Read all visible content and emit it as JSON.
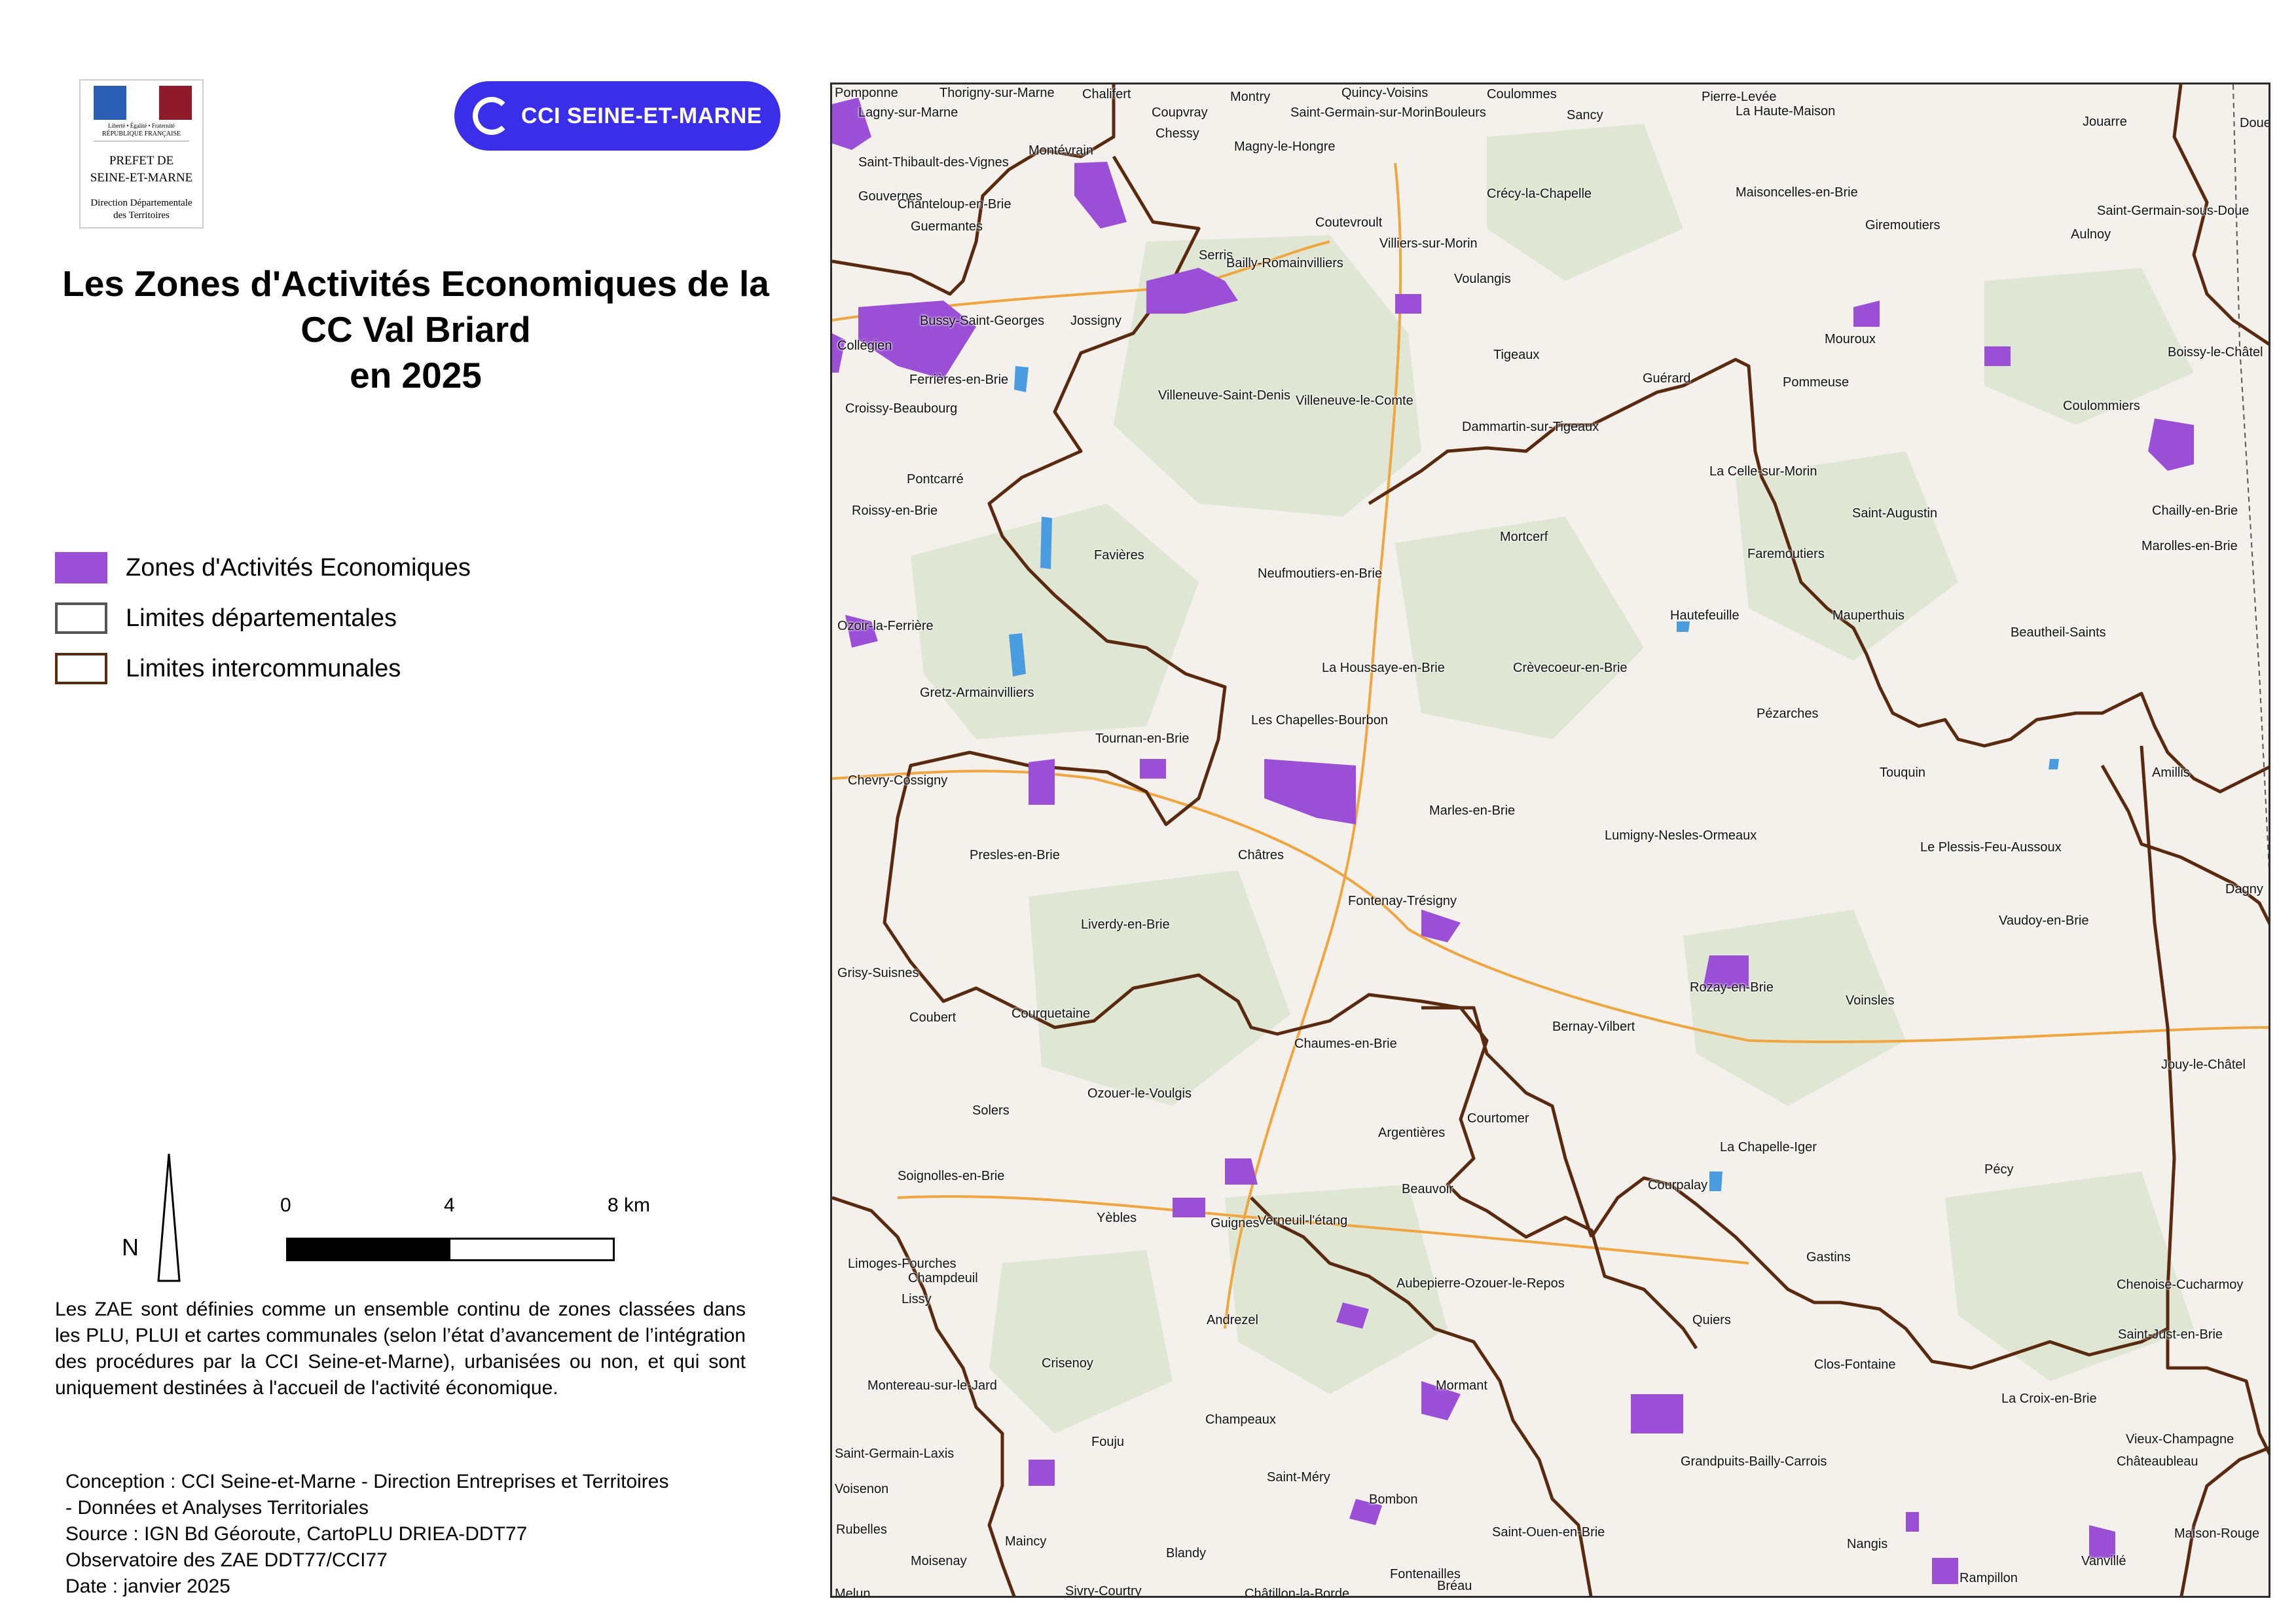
{
  "logos": {
    "prefet": {
      "motto": "Liberté • Égalité • Fraternité",
      "republic": "RÉPUBLIQUE FRANÇAISE",
      "line1": "PREFET DE",
      "line2": "SEINE-ET-MARNE",
      "line3": "Direction Départementale",
      "line4": "des Territoires",
      "flag_colors": [
        "#2a5fb5",
        "#ffffff",
        "#8f1a2a"
      ]
    },
    "cci": {
      "label": "CCI SEINE-ET-MARNE",
      "color": "#3a2ee8"
    }
  },
  "title": {
    "line1": "Les Zones d'Activités Economiques de la",
    "line2": "CC Val Briard",
    "line3": "en 2025"
  },
  "legend": [
    {
      "label": "Zones d'Activités Economiques",
      "fill": "#9b4fd6",
      "stroke": "#9b4fd6"
    },
    {
      "label": "Limites départementales",
      "fill": "#ffffff",
      "stroke": "#555555"
    },
    {
      "label": "Limites intercommunales",
      "fill": "#ffffff",
      "stroke": "#5a2a10"
    }
  ],
  "north_label": "N",
  "scale": {
    "labels": [
      "0",
      "4",
      "8 km"
    ]
  },
  "definition": "Les ZAE sont définies comme un ensemble continu de zones classées dans les PLU, PLUI et cartes communales (selon l’état d’avancement de l’intégration des procédures par la CCI Seine-et-Marne), urbanisées ou non, et qui sont uniquement destinées à l'accueil de l'activité économique.",
  "credits": [
    "Conception : CCI Seine-et-Marne - Direction Entreprises et Territoires",
    "- Données et Analyses Territoriales",
    "Source : IGN Bd Géoroute, CartoPLU DRIEA-DDT77",
    "Observatoire des ZAE DDT77/CCI77",
    "Date : janvier 2025"
  ],
  "map": {
    "colors": {
      "base": "#f4f1ec",
      "forest": "#dfe6d3",
      "zae": "#9b4fd6",
      "boundary": "#5a2a10",
      "road": "#f0a640",
      "water": "#4a9be0"
    },
    "towns": [
      "Pomponne",
      "Thorigny-sur-Marne",
      "Chalifert",
      "Montry",
      "Quincy-Voisins",
      "Coulommes",
      "Pierre-Levée",
      "Lagny-sur-Marne",
      "Coupvray",
      "Saint-Germain-sur-Morin",
      "Bouleurs",
      "Sancy",
      "La Haute-Maison",
      "Jouarre",
      "Doue",
      "Chessy",
      "Magny-le-Hongre",
      "Saint-Thibault-des-Vignes",
      "Montévrain",
      "Crécy-la-Chapelle",
      "Maisoncelles-en-Brie",
      "Gouvernes",
      "Chanteloup-en-Brie",
      "Saint-Germain-sous-Doue",
      "Guermantes",
      "Coutevroult",
      "Giremoutiers",
      "Aulnoy",
      "Villiers-sur-Morin",
      "Serris",
      "Bailly-Romainvilliers",
      "Voulangis",
      "Bussy-Saint-Georges",
      "Jossigny",
      "Mouroux",
      "Collégien",
      "Tigeaux",
      "Boissy-le-Châtel",
      "Ferrières-en-Brie",
      "Guérard",
      "Pommeuse",
      "Villeneuve-Saint-Denis",
      "Villeneuve-le-Comte",
      "Coulommiers",
      "Croissy-Beaubourg",
      "Dammartin-sur-Tigeaux",
      "La Celle-sur-Morin",
      "Pontcarré",
      "Chailly-en-Brie",
      "Roissy-en-Brie",
      "Saint-Augustin",
      "Mortcerf",
      "Marolles-en-Brie",
      "Faremoutiers",
      "Favières",
      "Neufmoutiers-en-Brie",
      "Hautefeuille",
      "Mauperthuis",
      "Ozoir-la-Ferrière",
      "Beautheil-Saints",
      "La Houssaye-en-Brie",
      "Crèvecoeur-en-Brie",
      "Gretz-Armainvilliers",
      "Pézarches",
      "Les Chapelles-Bourbon",
      "Tournan-en-Brie",
      "Touquin",
      "Amillis",
      "Chevry-Cossigny",
      "Marles-en-Brie",
      "Lumigny-Nesles-Ormeaux",
      "Le Plessis-Feu-Aussoux",
      "Presles-en-Brie",
      "Châtres",
      "Dagny",
      "Fontenay-Trésigny",
      "Vaudoy-en-Brie",
      "Liverdy-en-Brie",
      "Grisy-Suisnes",
      "Rozay-en-Brie",
      "Voinsles",
      "Coubert",
      "Courquetaine",
      "Bernay-Vilbert",
      "Chaumes-en-Brie",
      "Jouy-le-Châtel",
      "Ozouer-le-Voulgis",
      "Solers",
      "Courtomer",
      "Argentières",
      "La Chapelle-Iger",
      "Soignolles-en-Brie",
      "Courpalay",
      "Beauvoir",
      "Pécy",
      "Yèbles",
      "Guignes",
      "Verneuil-l'étang",
      "Gastins",
      "Limoges-Fourches",
      "Champdeuil",
      "Aubepierre-Ozouer-le-Repos",
      "Chenoise-Cucharmoy",
      "Lissy",
      "Andrezel",
      "Quiers",
      "Saint-Just-en-Brie",
      "Crisenoy",
      "Clos-Fontaine",
      "Montereau-sur-le-Jard",
      "Mormant",
      "La Croix-en-Brie",
      "Champeaux",
      "Vieux-Champagne",
      "Fouju",
      "Saint-Germain-Laxis",
      "Grandpuits-Bailly-Carrois",
      "Châteaubleau",
      "Saint-Méry",
      "Voisenon",
      "Bombon",
      "Rubelles",
      "Saint-Ouen-en-Brie",
      "Nangis",
      "Maison-Rouge",
      "Moisenay",
      "Maincy",
      "Blandy",
      "Vanvillé",
      "Fontenailles",
      "Bréau",
      "Melun",
      "Sivry-Courtry",
      "Châtillon-la-Borde",
      "Rampillon"
    ]
  }
}
